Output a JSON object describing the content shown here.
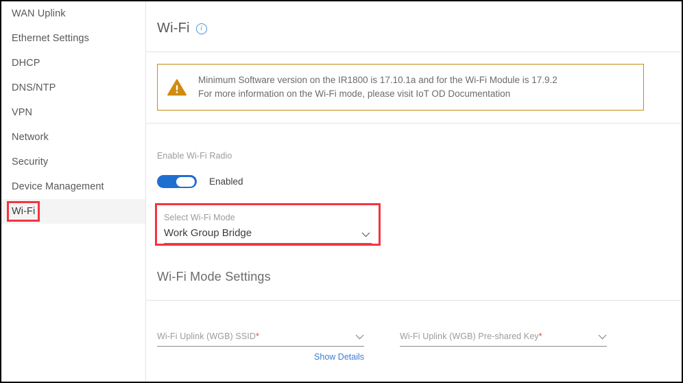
{
  "sidebar": {
    "items": [
      {
        "label": "WAN Uplink",
        "active": false
      },
      {
        "label": "Ethernet Settings",
        "active": false
      },
      {
        "label": "DHCP",
        "active": false
      },
      {
        "label": "DNS/NTP",
        "active": false
      },
      {
        "label": "VPN",
        "active": false
      },
      {
        "label": "Network",
        "active": false
      },
      {
        "label": "Security",
        "active": false
      },
      {
        "label": "Device Management",
        "active": false
      },
      {
        "label": "Wi-Fi",
        "active": true
      }
    ]
  },
  "header": {
    "title": "Wi-Fi",
    "info_icon": "info-icon",
    "info_glyph": "i"
  },
  "banner": {
    "icon": "warning-triangle-icon",
    "line1": "Minimum Software version on the IR1800 is 17.10.1a and for the Wi-Fi Module is 17.9.2",
    "line2": "For more information on the Wi-Fi mode, please visit IoT OD Documentation",
    "border_color": "#c98a09",
    "icon_color": "#d08b10"
  },
  "radio": {
    "label": "Enable Wi-Fi Radio",
    "toggle_state": "Enabled",
    "toggle_on": true,
    "accent_color": "#1f6fd0"
  },
  "mode_select": {
    "label": "Select Wi-Fi Mode",
    "value": "Work Group Bridge",
    "chevron_icon": "chevron-down-icon",
    "highlight_color": "#f5333f"
  },
  "settings_section": {
    "title": "Wi-Fi Mode Settings",
    "fields": [
      {
        "label": "Wi-Fi Uplink (WGB) SSID",
        "required_marker": "*",
        "chevron_icon": "chevron-down-icon"
      },
      {
        "label": "Wi-Fi Uplink (WGB) Pre-shared Key",
        "required_marker": "*",
        "chevron_icon": "chevron-down-icon"
      }
    ],
    "show_details_link": "Show Details",
    "link_color": "#3b7dd8"
  }
}
